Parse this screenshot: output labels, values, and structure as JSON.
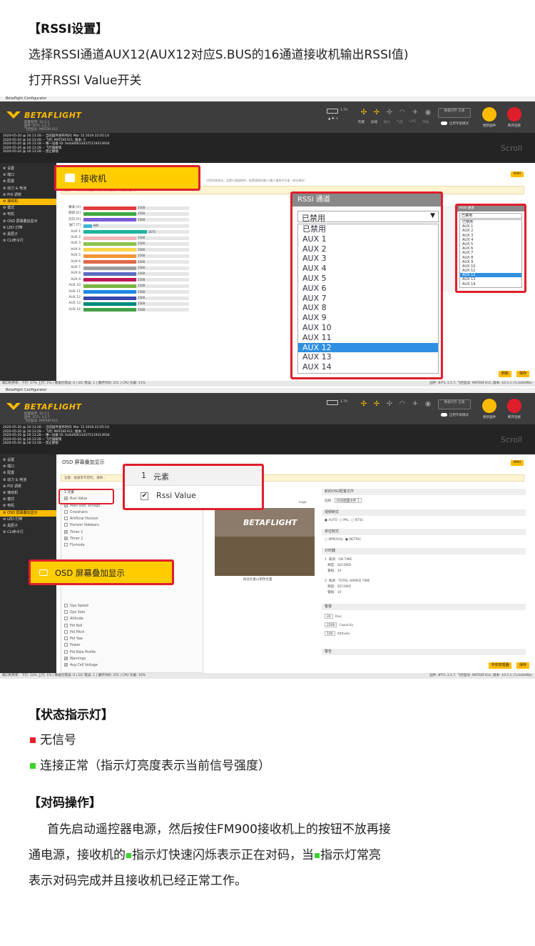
{
  "colors": {
    "accent": "#ffbb00",
    "callout": "#e01e2b",
    "red_led": "#e8202a",
    "green_led": "#39d42a",
    "selected": "#2f8fe0"
  },
  "section1": {
    "heading": "【RSSI设置】",
    "line1": "选择RSSI通道AUX12(AUX12对应S.BUS的16通道接收机输出RSSI值)",
    "line2": "打开RSSI Value开关"
  },
  "app": {
    "window_title": "Betaflight Configurator",
    "logo": "BETAFLIGHT",
    "logo_sub1": "配置程序: 10.5.1",
    "logo_sub2": "固件: BTFL 3.5.7",
    "logo_sub3": "飞控型号: MATEKF411",
    "battery": "1.7V",
    "sensors": [
      "陀螺",
      "加速",
      "磁力",
      "气压",
      "GPS",
      "声呐"
    ],
    "sensor_icons": [
      "gyro-icon",
      "accel-icon",
      "mag-icon",
      "baro-icon",
      "gps-icon",
      "sonar-icon"
    ],
    "dataflash_btn": "数据闪存 已满",
    "expert_mode": "启用专家模式",
    "update_label": "更新固件",
    "disconnect_label": "断开连接",
    "scroll": "Scroll",
    "log_lines": [
      "2020-05-20 @ 16:13:28 -- 当前固件发布时间: Mar 15 2019 22:05:14",
      "2020-05-20 @ 16:13:28 -- 飞控: MATEKF411, 版本: 0",
      "2020-05-20 @ 16:13:28 -- 唯一设备 ID: 0x4a006134375119313934",
      "2020-05-20 @ 16:13:28 -- 飞行器解锁",
      "2020-05-20 @ 16:13:28 -- 禁止解锁"
    ],
    "sidebar": [
      "设置",
      "端口",
      "配置",
      "动力 & 电池",
      "PID 调校",
      "接收机",
      "模式",
      "电机",
      "OSD 屏幕叠加显示",
      "LED 灯带",
      "黑匣子",
      "CLI命令行"
    ],
    "sidebar_icons": [
      "wrench-icon",
      "plug-icon",
      "gear-icon",
      "battery-icon",
      "pid-icon",
      "receiver-icon",
      "modes-icon",
      "motor-icon",
      "osd-icon",
      "led-icon",
      "blackbox-icon",
      "cli-icon"
    ],
    "status1": "端口利用率：下行: 17% 上行: 1%  |  数据包错误: 0  |  I2C 错误: 1  |  循环时间: 251  |  CPU 负载: 11%",
    "status2": "端口利用率：下行: 23% 上行: 1%  |  数据包错误: 0  |  I2C 错误: 1  |  循环时间: 255  |  CPU 负载: 10%",
    "version": "固件: BTFL 3.5.7, 飞控型号: MATEKF411, 版本: 10.5.1 (7c3c6ef6b)",
    "wiki": "WIKI"
  },
  "receiver": {
    "tab_title": "接收机",
    "notice": "注意：飞行前请检查所有接收机通道映射是否正确。",
    "channels": [
      {
        "label": "横滚 [A]",
        "value": 1500,
        "pct": 0.5,
        "color": "#e23c3c"
      },
      {
        "label": "俯仰 [E]",
        "value": 1500,
        "pct": 0.5,
        "color": "#3fa83f"
      },
      {
        "label": "方向 [R]",
        "value": 1500,
        "pct": 0.5,
        "color": "#7a5bd6"
      },
      {
        "label": "油门 [T]",
        "value": 885,
        "pct": 0.08,
        "color": "#3fb7d8"
      },
      {
        "label": "AUX 1",
        "value": 1675,
        "pct": 0.6,
        "color": "#22b3a0"
      },
      {
        "label": "AUX 2",
        "value": 1500,
        "pct": 0.5,
        "color": "#f2b4b4"
      },
      {
        "label": "AUX 3",
        "value": 1500,
        "pct": 0.5,
        "color": "#8bc34a"
      },
      {
        "label": "AUX 4",
        "value": 1500,
        "pct": 0.5,
        "color": "#f7d54a"
      },
      {
        "label": "AUX 5",
        "value": 1500,
        "pct": 0.5,
        "color": "#f2963a"
      },
      {
        "label": "AUX 6",
        "value": 1500,
        "pct": 0.5,
        "color": "#e06a4a"
      },
      {
        "label": "AUX 7",
        "value": 1500,
        "pct": 0.5,
        "color": "#9e9e9e"
      },
      {
        "label": "AUX 8",
        "value": 1500,
        "pct": 0.5,
        "color": "#5c6bc0"
      },
      {
        "label": "AUX 9",
        "value": 1500,
        "pct": 0.5,
        "color": "#c2185b"
      },
      {
        "label": "AUX 10",
        "value": 1500,
        "pct": 0.5,
        "color": "#7cb342"
      },
      {
        "label": "AUX 11",
        "value": 1500,
        "pct": 0.5,
        "color": "#1e88e5"
      },
      {
        "label": "AUX 12",
        "value": 1500,
        "pct": 0.5,
        "color": "#3949ab"
      },
      {
        "label": "AUX 13",
        "value": 1500,
        "pct": 0.5,
        "color": "#00897b"
      },
      {
        "label": "AUX 14",
        "value": 1500,
        "pct": 0.5,
        "color": "#43a047"
      }
    ],
    "rssi_title": "RSSI 通道",
    "rssi_selected": "已禁用",
    "rssi_options": [
      "已禁用",
      "AUX 1",
      "AUX 2",
      "AUX 3",
      "AUX 4",
      "AUX 5",
      "AUX 6",
      "AUX 7",
      "AUX 8",
      "AUX 9",
      "AUX 10",
      "AUX 11",
      "AUX 12",
      "AUX 13",
      "AUX 14"
    ],
    "rssi_selected_index": 12,
    "refresh_btn": "刷新",
    "save_btn": "保存"
  },
  "osd": {
    "tab_title": "OSD 屏幕叠加显示",
    "notice": "注意：帧速率不足时，请将...",
    "elements_header": "1  元素",
    "callout_header_num": "1",
    "callout_header_text": "元素",
    "callout_item": "Rssi Value",
    "elements": [
      {
        "label": "Rssi Value",
        "checked": true
      },
      {
        "label": "Main Batt Voltage",
        "checked": true
      },
      {
        "label": "Crosshairs",
        "checked": false
      },
      {
        "label": "Artificial Horizon",
        "checked": false
      },
      {
        "label": "Horizon Sidebars",
        "checked": false
      },
      {
        "label": "Timer 1",
        "checked": true
      },
      {
        "label": "Timer 2",
        "checked": true
      },
      {
        "label": "Flymode",
        "checked": false
      }
    ],
    "elements_lower": [
      {
        "label": "Gps Speed",
        "checked": false
      },
      {
        "label": "Gps Sats",
        "checked": false
      },
      {
        "label": "Altitude",
        "checked": false
      },
      {
        "label": "Pid Roll",
        "checked": false
      },
      {
        "label": "Pid Pitch",
        "checked": false
      },
      {
        "label": "Pid Yaw",
        "checked": false
      },
      {
        "label": "Power",
        "checked": false
      },
      {
        "label": "Pid Rate Profile",
        "checked": false
      },
      {
        "label": "Warnings",
        "checked": true
      },
      {
        "label": "Avg Cell Voltage",
        "checked": true
      }
    ],
    "preview_caption": "拖动元素以更改位置",
    "preview_logo": "BETAFLIGHT",
    "logo_label": "Logo",
    "right_head": "新的OSD配置文件",
    "profile_label": "OSD配置文件 1",
    "video_format": "视频制式",
    "video_opts": [
      "AUTO",
      "PAL",
      "NTSC"
    ],
    "units": "单位制式",
    "unit_opts": [
      "IMPERIAL",
      "METRIC"
    ],
    "timers": "计时器",
    "timer1": [
      "来源：ON TIME",
      "精度：SECOND",
      "警报：10"
    ],
    "timer2": [
      "来源：TOTAL ARMED TIME",
      "精度：SECOND",
      "警报：10"
    ],
    "alarms": "警报",
    "alarm_rows": [
      {
        "v": "20",
        "l": "Rssi"
      },
      {
        "v": "2200",
        "l": "Capacity"
      },
      {
        "v": "100",
        "l": "Altitude"
      }
    ],
    "warnings": "警告",
    "font_btn": "字体管理器",
    "save_btn": "保存",
    "callout_label": "OSD 屏幕叠加显示"
  },
  "section2": {
    "heading": "【状态指示灯】",
    "item1": "无信号",
    "item2": "连接正常（指示灯亮度表示当前信号强度）"
  },
  "section3": {
    "heading": "【对码操作】",
    "p1a": "首先启动遥控器电源，然后按住FM900接收机上的按钮不放再接",
    "p2a": "通电源，接收机的",
    "p2b": "指示灯快速闪烁表示正在对码，当",
    "p2c": "指示灯常亮",
    "p3": "表示对码完成并且接收机已经正常工作。"
  }
}
